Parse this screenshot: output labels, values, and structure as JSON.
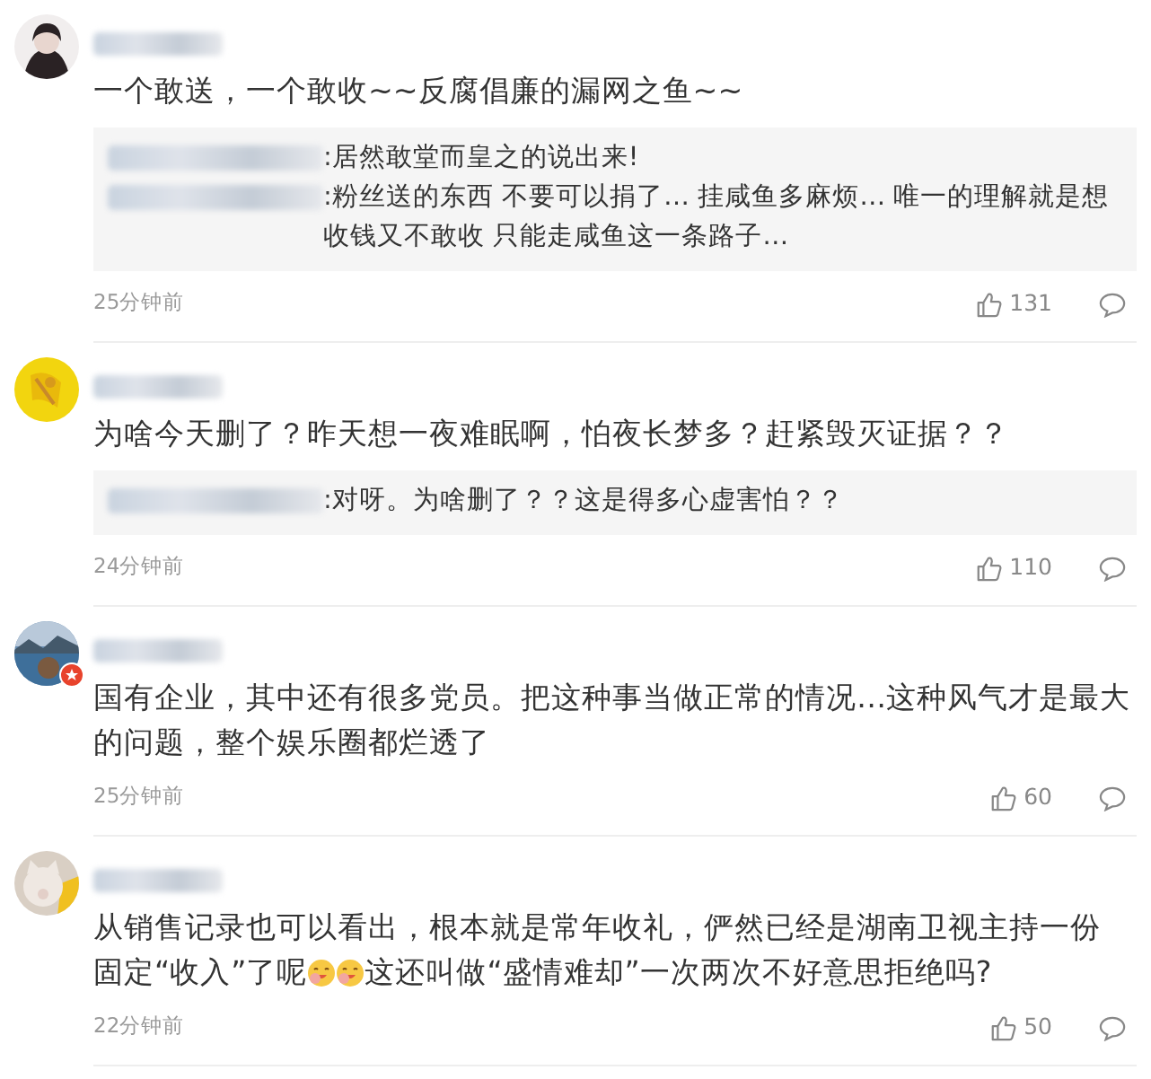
{
  "comments": [
    {
      "avatar": {
        "kind": "picture"
      },
      "verified": false,
      "lines": [
        [
          {
            "kind": "text",
            "text": "一个敢送，一个敢收~~反腐倡廉的漏网之鱼~~"
          }
        ]
      ],
      "replies": [
        {
          "text": ":居然敢堂而皇之的说出来!"
        },
        {
          "text": ":粉丝送的东西 不要可以捐了… 挂咸鱼多麻烦… 唯一的理解就是想收钱又不敢收 只能走咸鱼这一条路子…"
        }
      ],
      "time": "25分钟前",
      "likes": "131"
    },
    {
      "avatar": {
        "kind": "picture"
      },
      "verified": false,
      "lines": [
        [
          {
            "kind": "text",
            "text": "为啥今天删了？昨天想一夜难眠啊，怕夜长梦多？赶紧毁灭证据？？"
          }
        ]
      ],
      "replies": [
        {
          "text": ":对呀。为啥删了？？这是得多心虚害怕？？"
        }
      ],
      "time": "24分钟前",
      "likes": "110"
    },
    {
      "avatar": {
        "kind": "picture"
      },
      "verified": true,
      "lines": [
        [
          {
            "kind": "text",
            "text": "国有企业，其中还有很多党员。把这种事当做正常的情况…这种风气才是最大的问题，整个娱乐圈都烂透了"
          }
        ]
      ],
      "time": "25分钟前",
      "likes": "60"
    },
    {
      "avatar": {
        "kind": "picture"
      },
      "verified": false,
      "lines": [
        [
          {
            "kind": "text",
            "text": "从销售记录也可以看出，根本就是常年收礼，俨然已经是湖南卫视主持一份"
          }
        ],
        [
          {
            "kind": "text",
            "text": "固定“收入”了呢"
          },
          {
            "kind": "emoji"
          },
          {
            "kind": "emoji"
          },
          {
            "kind": "text",
            "text": "这还叫做“盛情难却”一次两次不好意思拒绝吗?"
          }
        ]
      ],
      "time": "22分钟前",
      "likes": "50"
    }
  ]
}
